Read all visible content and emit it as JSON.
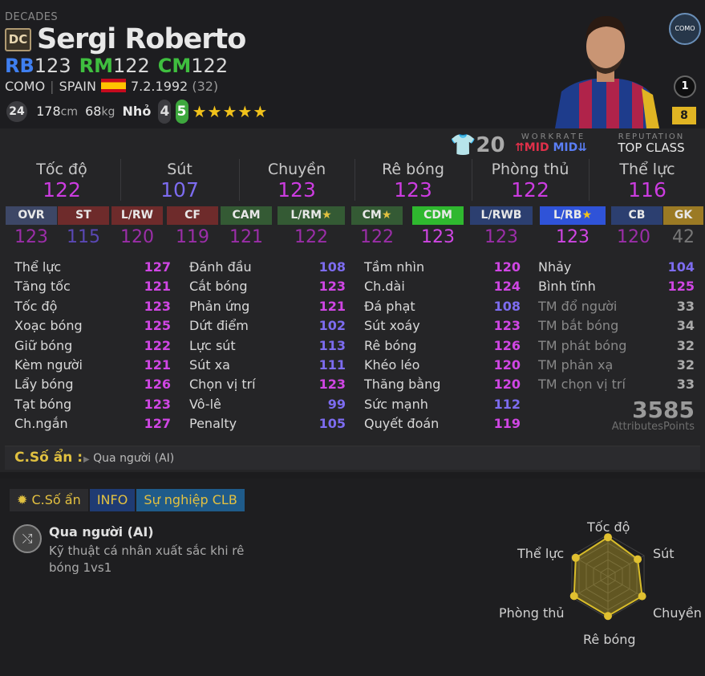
{
  "header": {
    "season": "DECADES",
    "season_badge": "DC",
    "name": "Sergi Roberto",
    "positions": [
      {
        "pos": "RB",
        "ovr": "123",
        "color": "#3f7ff0"
      },
      {
        "pos": "RM",
        "ovr": "122",
        "color": "#3fbf3f"
      },
      {
        "pos": "CM",
        "ovr": "122",
        "color": "#3fbf3f"
      }
    ],
    "club": "COMO",
    "nation": "SPAIN",
    "birthdate": "7.2.1992",
    "age": "(32)",
    "shirt_circle": "24",
    "height": "178",
    "height_unit": "cm",
    "weight": "68",
    "weight_unit": "kg",
    "body_type": "Nhỏ",
    "weak_foot": "4",
    "skill_moves": "5",
    "stars": "★★★★★",
    "club_badge": "COMO",
    "rank": "1",
    "enhance_level": "8"
  },
  "meta": {
    "shirt_number": "20",
    "workrate_label": "WORKRATE",
    "workrate_att": "MID",
    "workrate_def": "MID",
    "reputation_label": "REPUTATION",
    "reputation": "TOP CLASS"
  },
  "summary": [
    {
      "name": "Tốc độ",
      "value": "122"
    },
    {
      "name": "Sút",
      "value": "107"
    },
    {
      "name": "Chuyền",
      "value": "123"
    },
    {
      "name": "Rê bóng",
      "value": "123"
    },
    {
      "name": "Phòng thủ",
      "value": "122"
    },
    {
      "name": "Thể lực",
      "value": "116"
    }
  ],
  "position_ratings": [
    {
      "pos": "OVR",
      "value": "123",
      "bg": "#3d4766",
      "star": false
    },
    {
      "pos": "ST",
      "value": "115",
      "bg": "#6e2b2b",
      "star": false
    },
    {
      "pos": "L/RW",
      "value": "120",
      "bg": "#6e2b2b",
      "star": false
    },
    {
      "pos": "CF",
      "value": "119",
      "bg": "#6e2b2b",
      "star": false
    },
    {
      "pos": "CAM",
      "value": "121",
      "bg": "#345a34",
      "star": false
    },
    {
      "pos": "L/RM",
      "value": "122",
      "bg": "#345a34",
      "star": true
    },
    {
      "pos": "CM",
      "value": "122",
      "bg": "#345a34",
      "star": true
    },
    {
      "pos": "CDM",
      "value": "123",
      "bg": "#2fb82f",
      "star": false
    },
    {
      "pos": "L/RWB",
      "value": "123",
      "bg": "#2c3f70",
      "star": false
    },
    {
      "pos": "L/RB",
      "value": "123",
      "bg": "#2f53d8",
      "star": true
    },
    {
      "pos": "CB",
      "value": "120",
      "bg": "#2c3f70",
      "star": false
    },
    {
      "pos": "GK",
      "value": "42",
      "bg": "#9b7a24",
      "star": false
    }
  ],
  "attributes": [
    [
      {
        "name": "Thể lực",
        "value": "127"
      },
      {
        "name": "Tăng tốc",
        "value": "121"
      },
      {
        "name": "Tốc độ",
        "value": "123"
      },
      {
        "name": "Xoạc bóng",
        "value": "125"
      },
      {
        "name": "Giữ bóng",
        "value": "122"
      },
      {
        "name": "Kèm người",
        "value": "121"
      },
      {
        "name": "Lẩy bóng",
        "value": "126"
      },
      {
        "name": "Tạt bóng",
        "value": "123"
      },
      {
        "name": "Ch.ngắn",
        "value": "127"
      }
    ],
    [
      {
        "name": "Đánh đầu",
        "value": "108"
      },
      {
        "name": "Cắt bóng",
        "value": "123"
      },
      {
        "name": "Phản ứng",
        "value": "121"
      },
      {
        "name": "Dứt điểm",
        "value": "102"
      },
      {
        "name": "Lực sút",
        "value": "113"
      },
      {
        "name": "Sút xa",
        "value": "111"
      },
      {
        "name": "Chọn vị trí",
        "value": "123"
      },
      {
        "name": "Vô-lê",
        "value": "99"
      },
      {
        "name": "Penalty",
        "value": "105"
      }
    ],
    [
      {
        "name": "Tầm nhìn",
        "value": "120"
      },
      {
        "name": "Ch.dài",
        "value": "124"
      },
      {
        "name": "Đá phạt",
        "value": "108"
      },
      {
        "name": "Sút xoáy",
        "value": "123"
      },
      {
        "name": "Rê bóng",
        "value": "126"
      },
      {
        "name": "Khéo léo",
        "value": "120"
      },
      {
        "name": "Thăng bằng",
        "value": "120"
      },
      {
        "name": "Sức mạnh",
        "value": "112"
      },
      {
        "name": "Quyết đoán",
        "value": "119"
      }
    ],
    [
      {
        "name": "Nhảy",
        "value": "104"
      },
      {
        "name": "Bình tĩnh",
        "value": "125"
      },
      {
        "name": "TM đổ người",
        "value": "33"
      },
      {
        "name": "TM bắt bóng",
        "value": "34"
      },
      {
        "name": "TM phát bóng",
        "value": "32"
      },
      {
        "name": "TM phản xạ",
        "value": "32"
      },
      {
        "name": "TM chọn vị trí",
        "value": "33"
      }
    ]
  ],
  "attribute_points": "3585",
  "attribute_points_label": "AttributesPoints",
  "hidden_stats": {
    "label": "C.Số ẩn :",
    "value": "Qua người (AI)"
  },
  "tabs": [
    {
      "label": "C.Số ẩn",
      "bg": "#2b2b2e"
    },
    {
      "label": "INFO",
      "bg": "#1f3b73"
    },
    {
      "label": "Sự nghiệp CLB",
      "bg": "#1f5b8a"
    }
  ],
  "skill": {
    "name": "Qua người (AI)",
    "description": "Kỹ thuật cá nhân xuất sắc khi rê bóng 1vs1"
  },
  "radar": {
    "labels": [
      "Tốc độ",
      "Sút",
      "Chuyền",
      "Rê bóng",
      "Phòng thủ",
      "Thể lực"
    ],
    "values": [
      122,
      107,
      123,
      123,
      122,
      116
    ],
    "max": 130
  },
  "colors": {
    "accent": "#e3c040",
    "high": "#d046e4",
    "mid": "#7d6cf0"
  }
}
